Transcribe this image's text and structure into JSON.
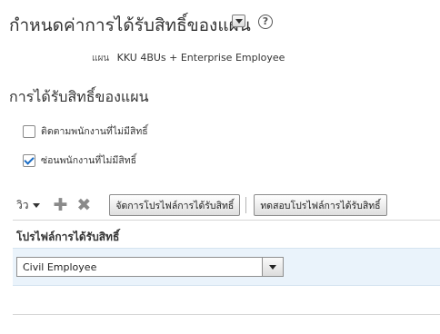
{
  "page": {
    "title": "กำหนดค่าการได้รับสิทธิ์ของแผน",
    "help_glyph": "?"
  },
  "plan": {
    "label": "แผน",
    "value": "KKU 4BUs + Enterprise Employee"
  },
  "section_title": "การได้รับสิทธิ์ของแผน",
  "options": [
    {
      "label": "ติดตามพนักงานที่ไม่มีสิทธิ์",
      "checked": false
    },
    {
      "label": "ซ่อนพนักงานที่ไม่มีสิทธิ์",
      "checked": true
    }
  ],
  "toolbar": {
    "view_label": "วิว",
    "add_glyph": "✚",
    "delete_glyph": "✖",
    "manage_button": "จัดการโปรไฟล์การได้รับสิทธิ์",
    "test_button": "ทดสอบโปรไฟล์การได้รับสิทธิ์"
  },
  "table": {
    "column_header": "โปรไฟล์การได้รับสิทธิ์",
    "rows": [
      {
        "profile": "Civil Employee"
      }
    ]
  },
  "icons": {
    "title_menu": "chevron-down-icon",
    "help": "help-icon",
    "add": "plus-icon",
    "delete": "x-icon"
  },
  "colors": {
    "selected_row_bg": "#eaf3fb",
    "checkbox_check": "#1a6cc4"
  }
}
